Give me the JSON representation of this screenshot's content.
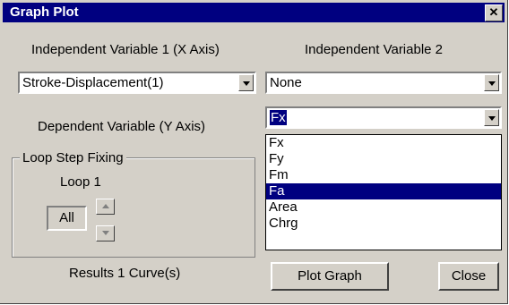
{
  "window": {
    "title": "Graph Plot"
  },
  "labels": {
    "independent1": "Independent Variable 1 (X Axis)",
    "independent2": "Independent Variable 2",
    "dependent": "Dependent Variable (Y Axis)",
    "loop_group": "Loop Step Fixing",
    "loop_label": "Loop 1",
    "results": "Results 1 Curve(s)"
  },
  "combos": {
    "x_axis": "Stroke-Displacement(1)",
    "var2": "None",
    "y_axis": "Fx"
  },
  "spinner": {
    "value": "All"
  },
  "dropdown": {
    "options": [
      "Fx",
      "Fy",
      "Fm",
      "Fa",
      "Area",
      "Chrg"
    ],
    "highlighted": "Fa"
  },
  "buttons": {
    "plot": "Plot Graph",
    "close": "Close"
  },
  "colors": {
    "titlebar": "#000080",
    "face": "#d4d0c8",
    "highlight": "#000080"
  }
}
